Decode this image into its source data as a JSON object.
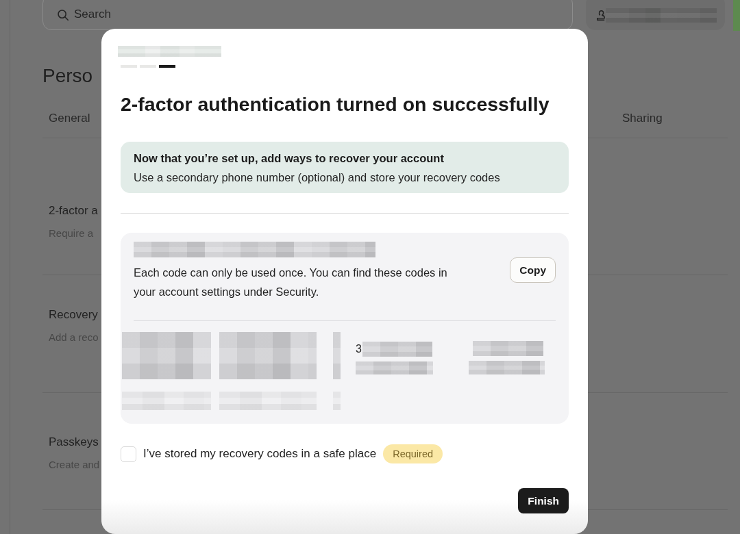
{
  "background_page": {
    "search": {
      "placeholder": "Search"
    },
    "heading": "Perso",
    "tabs": [
      {
        "label": "General"
      },
      {
        "label": "Sharing"
      }
    ],
    "settings_rows": [
      {
        "title": "2-factor a",
        "description": "Require a"
      },
      {
        "title": "Recovery",
        "description": "Add a reco"
      },
      {
        "title": "Passkeys",
        "description": "Create and"
      }
    ]
  },
  "dialog": {
    "steps": [
      {
        "selected": false
      },
      {
        "selected": false
      },
      {
        "selected": true
      }
    ],
    "title": "2-factor authentication turned on successfully",
    "notice": {
      "heading": "Now that you’re set up, add ways to recover your account",
      "text": "Use a secondary phone number (optional) and store your recovery codes"
    },
    "codes_panel": {
      "text": "Each code can only be used once. You can find these codes in your account settings under Security.",
      "copy_button": "Copy",
      "code_fragments": [
        "3"
      ]
    },
    "confirm": {
      "label": "I’ve stored my recovery codes in a safe place",
      "checked": false,
      "badge": "Required"
    },
    "finish_button": "Finish"
  }
}
